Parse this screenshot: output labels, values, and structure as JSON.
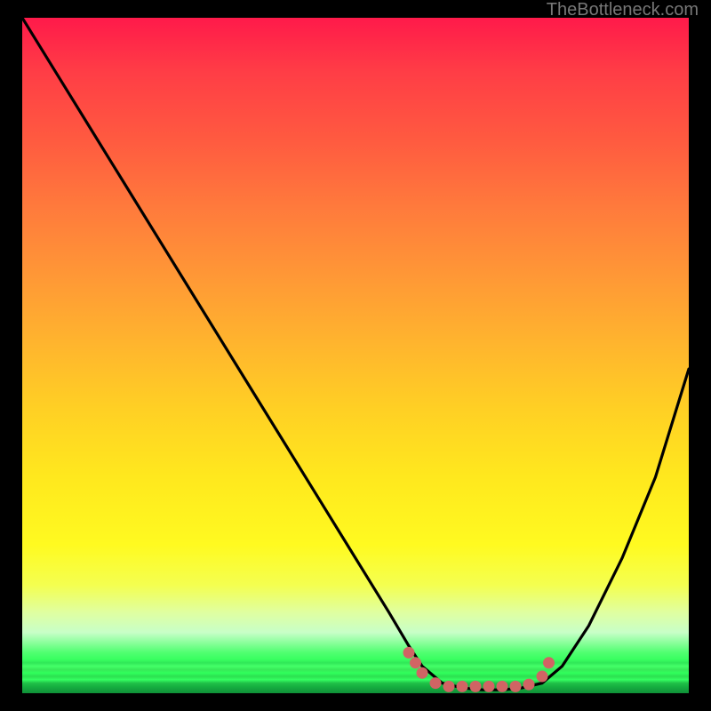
{
  "attribution": "TheBottleneck.com",
  "chart_data": {
    "type": "line",
    "title": "",
    "xlabel": "",
    "ylabel": "",
    "x_range": [
      0,
      100
    ],
    "y_range": [
      0,
      100
    ],
    "background_gradient": {
      "type": "vertical",
      "stops": [
        {
          "pos": 0,
          "color": "#ff1a4a"
        },
        {
          "pos": 50,
          "color": "#ffd028"
        },
        {
          "pos": 80,
          "color": "#fffa20"
        },
        {
          "pos": 94,
          "color": "#4fff70"
        },
        {
          "pos": 100,
          "color": "#109038"
        }
      ]
    },
    "series": [
      {
        "name": "bottleneck-curve",
        "color": "#000000",
        "x": [
          0,
          5,
          10,
          15,
          20,
          25,
          30,
          35,
          40,
          45,
          50,
          55,
          58,
          60,
          63,
          66,
          69,
          72,
          75,
          78,
          81,
          85,
          90,
          95,
          100
        ],
        "y": [
          100,
          92,
          84,
          76,
          68,
          60,
          52,
          44,
          36,
          28,
          20,
          12,
          7,
          4,
          1.5,
          0.8,
          0.5,
          0.5,
          0.8,
          1.5,
          4,
          10,
          20,
          32,
          48
        ]
      }
    ],
    "markers": {
      "color": "#d16464",
      "points": [
        {
          "x": 58,
          "y": 6
        },
        {
          "x": 59,
          "y": 4.5
        },
        {
          "x": 60,
          "y": 3
        },
        {
          "x": 62,
          "y": 1.5
        },
        {
          "x": 64,
          "y": 1.0
        },
        {
          "x": 66,
          "y": 1.0
        },
        {
          "x": 68,
          "y": 1.0
        },
        {
          "x": 70,
          "y": 1.0
        },
        {
          "x": 72,
          "y": 1.0
        },
        {
          "x": 74,
          "y": 1.0
        },
        {
          "x": 76,
          "y": 1.3
        },
        {
          "x": 78,
          "y": 2.5
        },
        {
          "x": 79,
          "y": 4.5
        }
      ]
    }
  }
}
